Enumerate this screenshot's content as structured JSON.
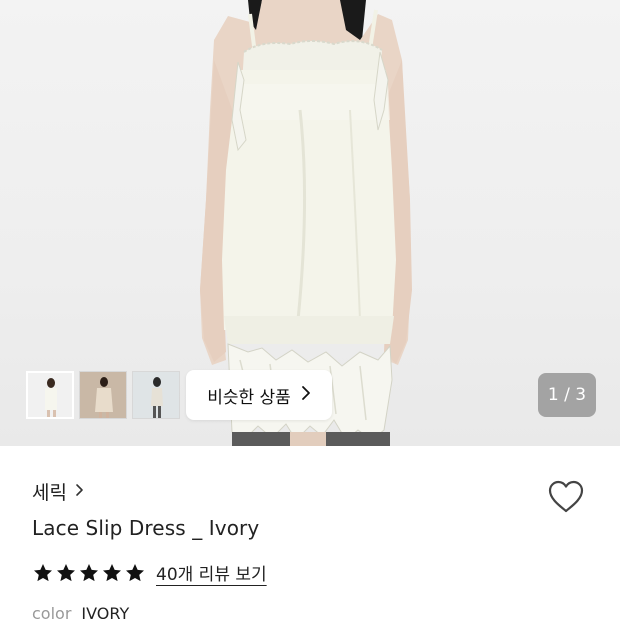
{
  "gallery": {
    "similar_button_label": "비슷한 상품",
    "counter": "1 / 3",
    "current_image": 1,
    "total_images": 3
  },
  "product": {
    "brand": "세릭",
    "title": "Lace Slip Dress _ Ivory",
    "rating_stars": 5,
    "review_link": "40개 리뷰 보기",
    "option_label": "color",
    "option_value": "IVORY"
  },
  "icons": {
    "brand_chevron": "chevron-right-icon",
    "similar_chevron": "chevron-right-icon",
    "wishlist": "heart-outline-icon",
    "star": "star-filled-icon"
  },
  "colors": {
    "star": "#111111",
    "counter_bg": "#7a7a7a",
    "photo_bg": "#efefef",
    "dress": "#f4f4ea"
  }
}
